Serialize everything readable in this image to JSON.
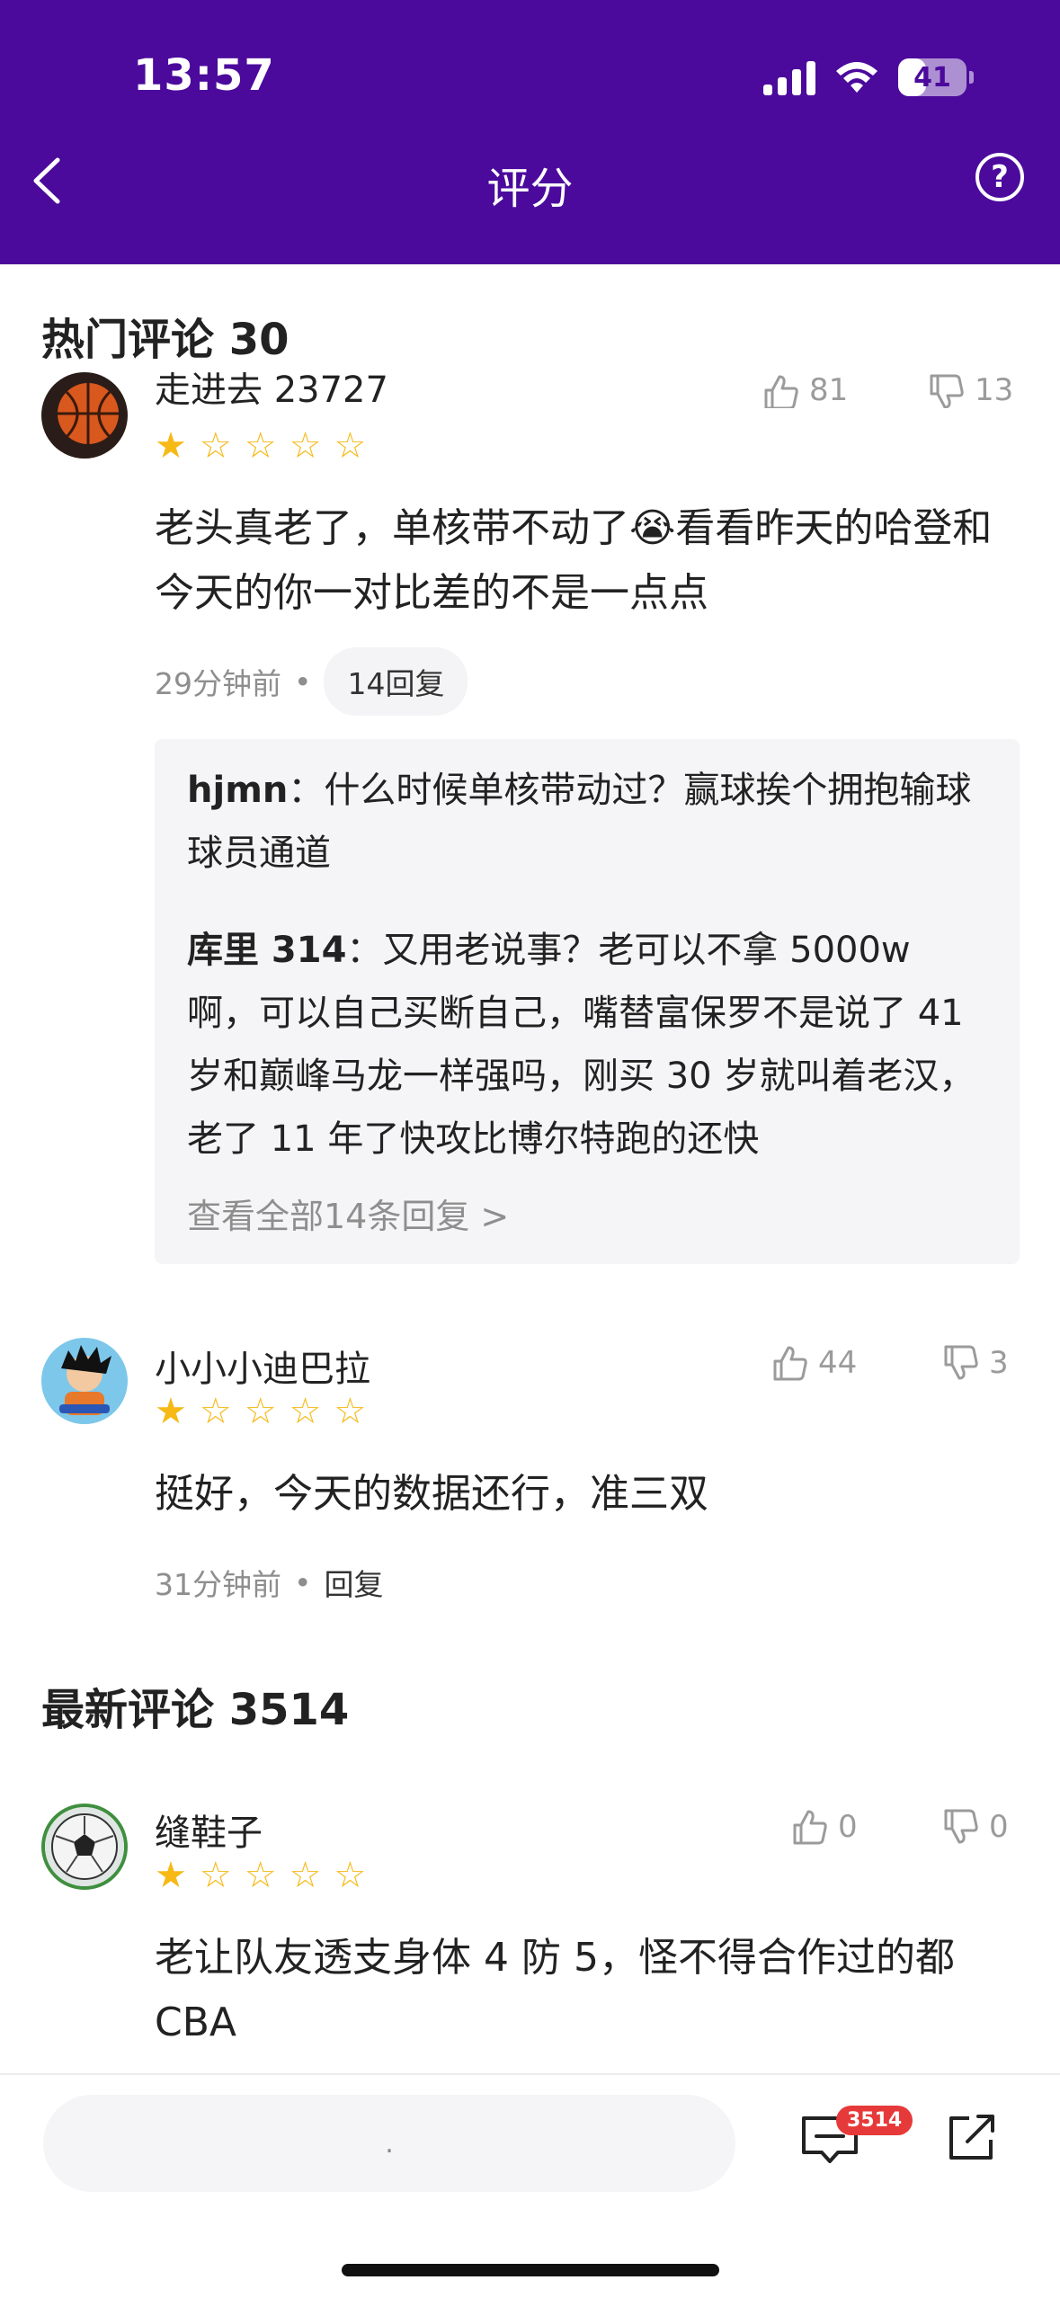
{
  "status": {
    "time": "13:57",
    "battery": "41",
    "battery_level_percent": 41
  },
  "nav": {
    "title": "评分",
    "help_glyph": "?"
  },
  "hot_section": {
    "title": "热门评论 30"
  },
  "latest_section": {
    "title": "最新评论 3514"
  },
  "comments": [
    {
      "username": "走进去 23727",
      "rating": 1,
      "likes": "81",
      "dislikes": "13",
      "text": "老头真老了，单核带不动了😭看看昨天的哈登和今天的你一对比差的不是一点点",
      "time": "29分钟前",
      "reply_label": "14回复",
      "replies": [
        {
          "author": "hjmn",
          "text": "什么时候单核带动过？赢球挨个拥抱输球球员通道"
        },
        {
          "author": "库里 314",
          "text": "又用老说事？老可以不拿 5000w 啊，可以自己买断自己，嘴替富保罗不是说了 41 岁和巅峰马龙一样强吗，刚买 30 岁就叫着老汉，老了 11 年了快攻比博尔特跑的还快"
        }
      ],
      "view_all": "查看全部14条回复 >"
    },
    {
      "username": "小小小迪巴拉",
      "rating": 1,
      "likes": "44",
      "dislikes": "3",
      "text": "挺好，今天的数据还行，准三双",
      "time": "31分钟前",
      "reply_label": "回复"
    },
    {
      "username": "缝鞋子",
      "rating": 1,
      "likes": "0",
      "dislikes": "0",
      "text": "老让队友透支身体 4 防 5，怪不得合作过的都 CBA"
    }
  ],
  "bottom_bar": {
    "input_placeholder": ".",
    "comment_count": "3514"
  },
  "colors": {
    "header_bg": "#4b0a9c",
    "star": "#f6b916",
    "badge": "#e63a3a"
  },
  "icons": [
    "back-icon",
    "help-icon",
    "thumbs-up-icon",
    "thumbs-down-icon",
    "comment-icon",
    "share-icon"
  ]
}
